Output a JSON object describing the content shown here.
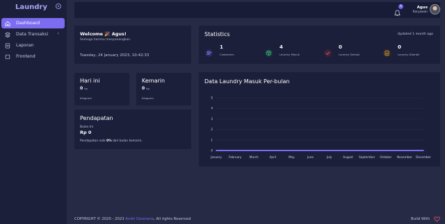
{
  "sidebar": {
    "brand": "Laundry",
    "items": [
      {
        "label": "Dashboard",
        "icon": "home-icon"
      },
      {
        "label": "Data Transaksi",
        "icon": "layers-icon"
      },
      {
        "label": "Laporan",
        "icon": "document-icon"
      },
      {
        "label": "Frontend",
        "icon": "square-icon"
      }
    ],
    "submenu_arrow": "›"
  },
  "topbar": {
    "notification_count": "4",
    "user_name": "Agus",
    "user_role": "Karyawan"
  },
  "welcome": {
    "title": "Welcome 🎉 Agus!",
    "subtitle": "Semoga harimu menyenangkan.",
    "datetime": "Tuesday, 24 January 2023, 10:42:33"
  },
  "statistics": {
    "title": "Statistics",
    "updated": "Updated 1 month ago",
    "items": [
      {
        "value": "1",
        "label": "Customers",
        "icon": "users-icon",
        "color": "#6f63ef"
      },
      {
        "value": "4",
        "label": "Laundry Masuk",
        "icon": "box-icon",
        "color": "#36c48a"
      },
      {
        "value": "0",
        "label": "Laundry Selesai",
        "icon": "check-icon",
        "color": "#e25a5a"
      },
      {
        "value": "0",
        "label": "Laundry Diambil",
        "icon": "clipboard-check-icon",
        "color": "#e3a042"
      }
    ]
  },
  "today": {
    "title": "Hari ini",
    "value": "0",
    "unit": "kg",
    "footer": "Kilogram"
  },
  "yesterday": {
    "title": "Kemarin",
    "value": "0",
    "unit": "kg",
    "footer": "Kilogram"
  },
  "income": {
    "title": "Pendapatan",
    "caption": "Bulan Ini",
    "value": "Rp 0",
    "note_prefix": "Pendapatan naik ",
    "note_percent": "0%",
    "note_suffix": " dari bulan kemarin."
  },
  "chart_card": {
    "title": "Data Laundry Masuk Per-bulan"
  },
  "chart_data": {
    "type": "line",
    "title": "Data Laundry Masuk Per-bulan",
    "categories": [
      "January",
      "February",
      "March",
      "April",
      "May",
      "June",
      "July",
      "August",
      "September",
      "October",
      "November",
      "December"
    ],
    "series": [
      {
        "values": [
          0,
          0,
          0,
          0,
          0,
          0,
          0,
          0,
          0,
          0,
          0,
          0
        ]
      }
    ],
    "yticks": [
      "0",
      "1",
      "2",
      "3",
      "4",
      "5"
    ],
    "ylim": [
      0,
      5
    ],
    "grid": true,
    "series_color": "#7b6cf0"
  },
  "footer": {
    "copyright": "COPYRIGHT © 2020 - 2023 ",
    "author": "Andri Desmana",
    "rights": ", All rights Reserved",
    "build_with": "Build With",
    "heart_icon": "heart-icon"
  },
  "colors": {
    "accent": "#7b6cf0",
    "sidebar_bg": "#1c1f3a",
    "page_bg": "#272a44",
    "card_bg": "#1c1f3a"
  }
}
